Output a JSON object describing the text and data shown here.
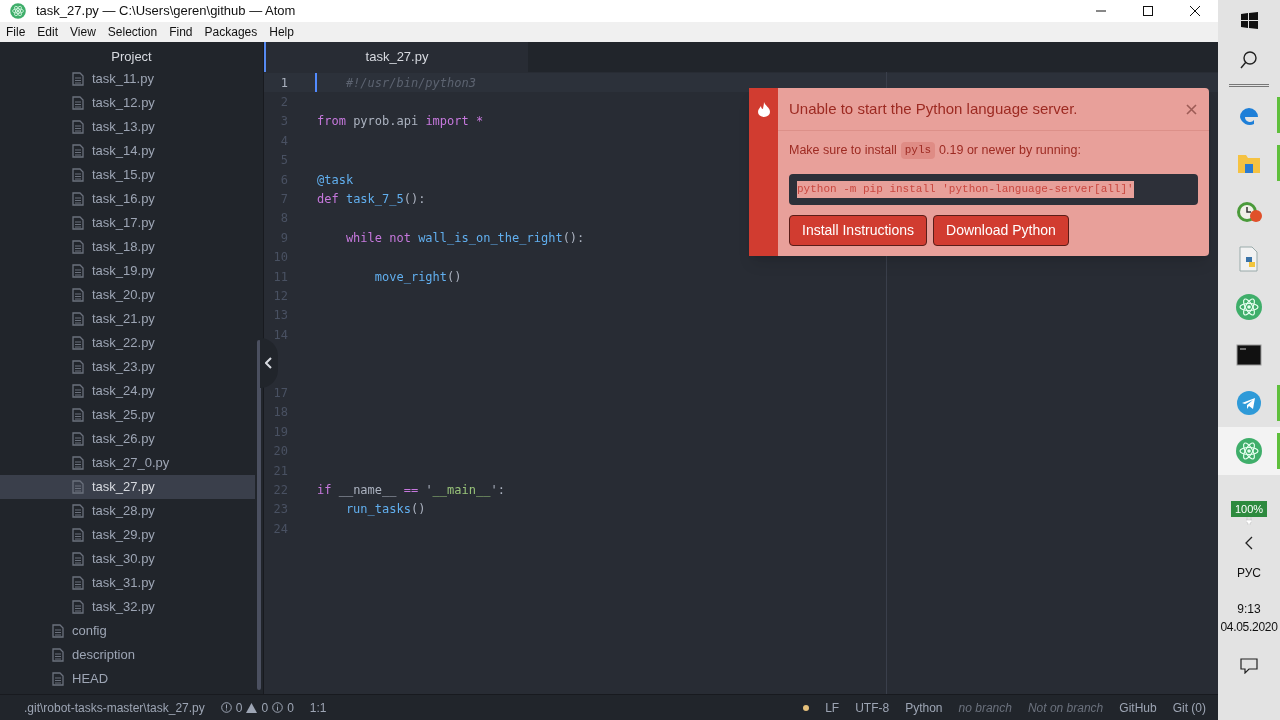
{
  "window": {
    "title": "task_27.py — C:\\Users\\geren\\github — Atom"
  },
  "menu": [
    "File",
    "Edit",
    "View",
    "Selection",
    "Find",
    "Packages",
    "Help"
  ],
  "sidebar": {
    "title": "Project",
    "nested_files": [
      {
        "name": "task_11.py",
        "selected": false
      },
      {
        "name": "task_12.py",
        "selected": false
      },
      {
        "name": "task_13.py",
        "selected": false
      },
      {
        "name": "task_14.py",
        "selected": false
      },
      {
        "name": "task_15.py",
        "selected": false
      },
      {
        "name": "task_16.py",
        "selected": false
      },
      {
        "name": "task_17.py",
        "selected": false
      },
      {
        "name": "task_18.py",
        "selected": false
      },
      {
        "name": "task_19.py",
        "selected": false
      },
      {
        "name": "task_20.py",
        "selected": false
      },
      {
        "name": "task_21.py",
        "selected": false
      },
      {
        "name": "task_22.py",
        "selected": false
      },
      {
        "name": "task_23.py",
        "selected": false
      },
      {
        "name": "task_24.py",
        "selected": false
      },
      {
        "name": "task_25.py",
        "selected": false
      },
      {
        "name": "task_26.py",
        "selected": false
      },
      {
        "name": "task_27_0.py",
        "selected": false
      },
      {
        "name": "task_27.py",
        "selected": true
      },
      {
        "name": "task_28.py",
        "selected": false
      },
      {
        "name": "task_29.py",
        "selected": false
      },
      {
        "name": "task_30.py",
        "selected": false
      },
      {
        "name": "task_31.py",
        "selected": false
      },
      {
        "name": "task_32.py",
        "selected": false
      }
    ],
    "files": [
      {
        "name": "config",
        "selected": false
      },
      {
        "name": "description",
        "selected": false
      },
      {
        "name": "HEAD",
        "selected": false
      }
    ]
  },
  "tabs": [
    {
      "label": "task_27.py",
      "selected": true
    }
  ],
  "editor": {
    "lines": [
      {
        "number": "1",
        "current": true,
        "tokens": [
          {
            "kind": "comment",
            "text": "    #!/usr/bin/python3"
          }
        ]
      },
      {
        "number": "2",
        "current": false
      },
      {
        "number": "3",
        "current": false,
        "tokens": [
          {
            "kind": "keyword",
            "text": "from"
          },
          {
            "kind": "plain",
            "text": " pyrob.api "
          },
          {
            "kind": "keyword",
            "text": "import"
          },
          {
            "kind": "keyword",
            "text": " *"
          }
        ]
      },
      {
        "number": "4",
        "current": false
      },
      {
        "number": "5",
        "current": false
      },
      {
        "number": "6",
        "current": false,
        "tokens": [
          {
            "kind": "function",
            "text": "@task"
          }
        ]
      },
      {
        "number": "7",
        "current": false,
        "tokens": [
          {
            "kind": "keyword",
            "text": "def"
          },
          {
            "kind": "function",
            "text": " task_7_5"
          },
          {
            "kind": "plain",
            "text": "():"
          }
        ]
      },
      {
        "number": "8",
        "current": false
      },
      {
        "number": "9",
        "current": false,
        "tokens": [
          {
            "kind": "keyword",
            "text": "    while not"
          },
          {
            "kind": "function",
            "text": " wall_is_on_the_right"
          },
          {
            "kind": "plain",
            "text": "():"
          }
        ]
      },
      {
        "number": "10",
        "current": false
      },
      {
        "number": "11",
        "current": false,
        "tokens": [
          {
            "kind": "function",
            "text": "        move_right"
          },
          {
            "kind": "plain",
            "text": "()"
          }
        ]
      },
      {
        "number": "12",
        "current": false
      },
      {
        "number": "13",
        "current": false
      },
      {
        "number": "14",
        "current": false
      },
      {
        "current": false
      },
      {
        "current": false
      },
      {
        "number": "17",
        "current": false
      },
      {
        "number": "18",
        "current": false
      },
      {
        "number": "19",
        "current": false
      },
      {
        "number": "20",
        "current": false
      },
      {
        "number": "21",
        "current": false
      },
      {
        "number": "22",
        "current": false,
        "tokens": [
          {
            "kind": "keyword",
            "text": "if"
          },
          {
            "kind": "plain",
            "text": " __name__ "
          },
          {
            "kind": "keyword",
            "text": "=="
          },
          {
            "kind": "plain",
            "text": " '"
          },
          {
            "kind": "string",
            "text": "__main__"
          },
          {
            "kind": "plain",
            "text": "':"
          }
        ]
      },
      {
        "number": "23",
        "current": false,
        "tokens": [
          {
            "kind": "function",
            "text": "    run_tasks"
          },
          {
            "kind": "plain",
            "text": "()"
          }
        ]
      },
      {
        "number": "24",
        "current": false
      }
    ]
  },
  "notification": {
    "title": "Unable to start the Python language server.",
    "message_before": "Make sure to install",
    "message_code": "pyls",
    "message_after": "0.19 or newer by running:",
    "command": "python -m pip install 'python-language-server[all]'",
    "buttons": [
      "Install Instructions",
      "Download Python"
    ]
  },
  "status_bar": {
    "path": ".git\\robot-tasks-master\\task_27.py",
    "errors": "0",
    "warnings": "0",
    "infos": "0",
    "cursor": "1:1",
    "line_ending": "LF",
    "encoding": "UTF-8",
    "grammar": "Python",
    "branch": "no branch",
    "git_state": "Not on branch",
    "github": "GitHub",
    "git": "Git (0)"
  },
  "taskbar": {
    "apps": [
      {
        "kind": "edge",
        "running": true,
        "selected": false
      },
      {
        "kind": "folder",
        "running": true,
        "selected": false
      },
      {
        "kind": "clock",
        "running": false,
        "selected": false
      },
      {
        "kind": "python",
        "running": false,
        "selected": false
      },
      {
        "kind": "atom",
        "running": false,
        "selected": false
      },
      {
        "kind": "terminal",
        "running": false,
        "selected": false
      },
      {
        "kind": "telegram",
        "running": true,
        "selected": false
      },
      {
        "kind": "atom",
        "running": true,
        "selected": true
      }
    ],
    "battery": "100%",
    "language": "РУС",
    "time": "9:13",
    "date": "04.05.2020"
  }
}
